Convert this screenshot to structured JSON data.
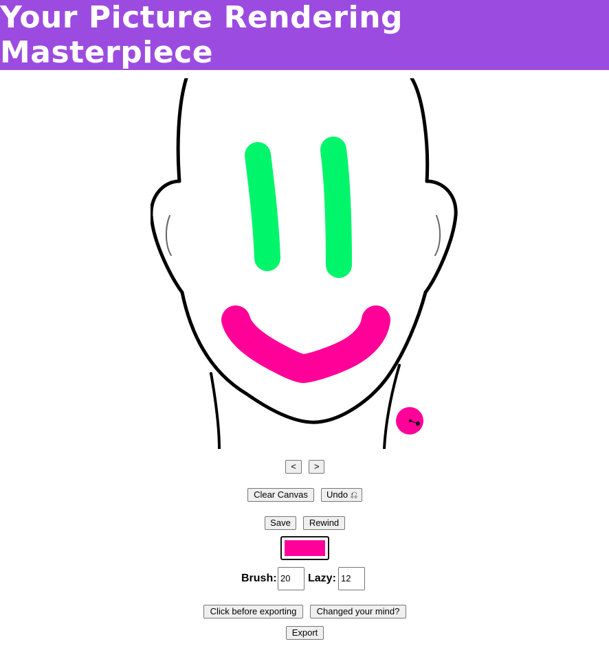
{
  "header": {
    "title": "Your Picture Rendering Masterpiece",
    "background": "#9c4be0"
  },
  "canvas": {
    "eye_color": "#00f56a",
    "mouth_color": "#ff0099",
    "outline_color": "#000000",
    "brush_cursor_color": "#ff0099"
  },
  "nav": {
    "prev_label": "<",
    "next_label": ">"
  },
  "toolbar": {
    "clear_label": "Clear Canvas",
    "undo_label": "Undo ⎌",
    "save_label": "Save",
    "rewind_label": "Rewind"
  },
  "color_picker": {
    "value": "#ff0099"
  },
  "settings": {
    "brush_label": "Brush:",
    "brush_value": "20",
    "lazy_label": "Lazy:",
    "lazy_value": "12"
  },
  "export": {
    "prepare_label": "Click before exporting",
    "changed_label": "Changed your mind?",
    "export_label": "Export"
  }
}
